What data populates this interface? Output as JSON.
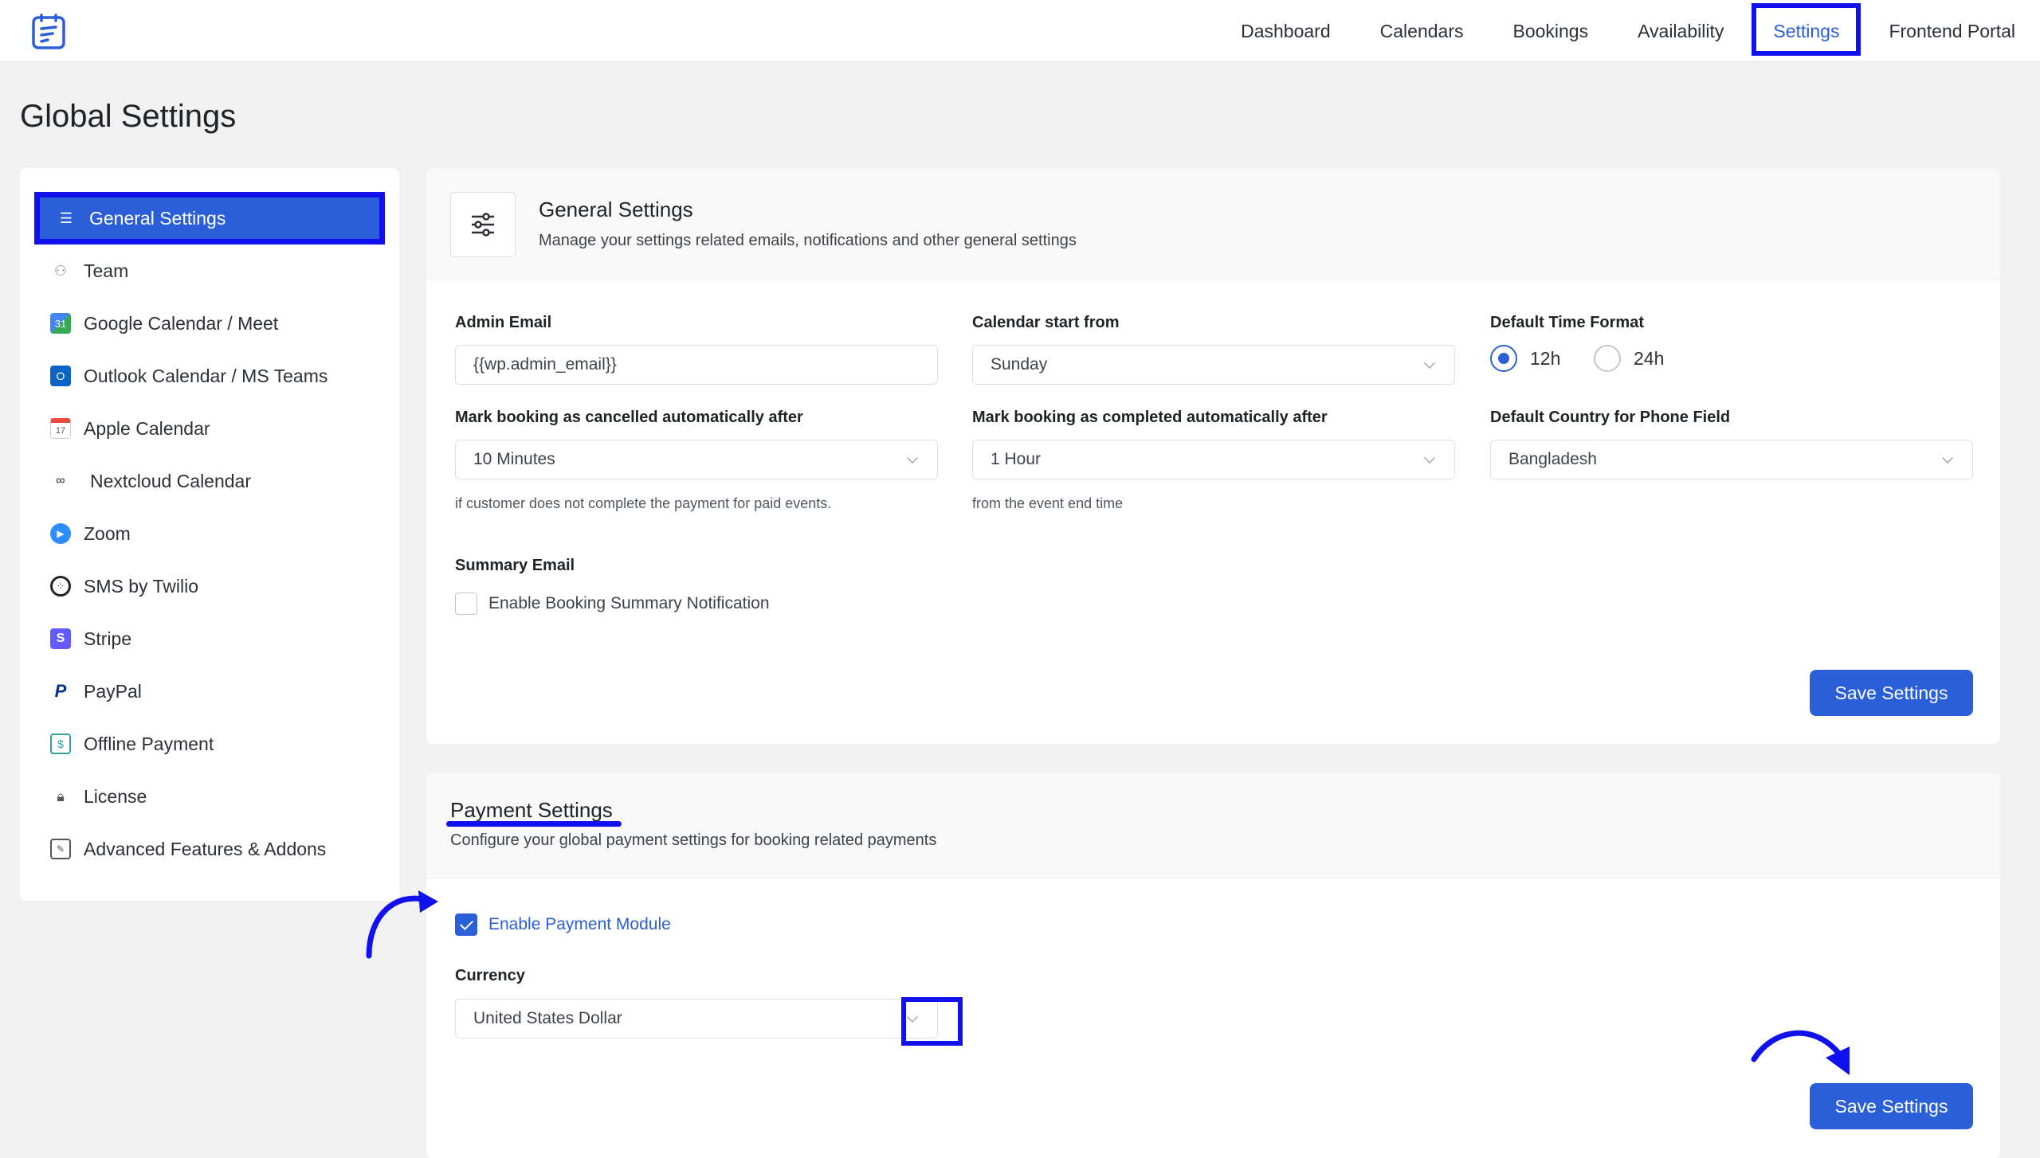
{
  "nav": {
    "items": [
      {
        "label": "Dashboard"
      },
      {
        "label": "Calendars"
      },
      {
        "label": "Bookings"
      },
      {
        "label": "Availability"
      },
      {
        "label": "Settings"
      },
      {
        "label": "Frontend Portal"
      }
    ],
    "active": "Settings"
  },
  "page": {
    "title": "Global Settings"
  },
  "sidebar": {
    "items": [
      {
        "label": "General Settings",
        "icon": "sliders-icon"
      },
      {
        "label": "Team",
        "icon": "team-icon"
      },
      {
        "label": "Google Calendar / Meet",
        "icon": "google-calendar-icon"
      },
      {
        "label": "Outlook Calendar / MS Teams",
        "icon": "outlook-icon"
      },
      {
        "label": "Apple Calendar",
        "icon": "apple-calendar-icon"
      },
      {
        "label": "Nextcloud Calendar",
        "icon": "nextcloud-icon"
      },
      {
        "label": "Zoom",
        "icon": "zoom-icon"
      },
      {
        "label": "SMS by Twilio",
        "icon": "twilio-icon"
      },
      {
        "label": "Stripe",
        "icon": "stripe-icon"
      },
      {
        "label": "PayPal",
        "icon": "paypal-icon"
      },
      {
        "label": "Offline Payment",
        "icon": "offline-payment-icon"
      },
      {
        "label": "License",
        "icon": "lock-icon"
      },
      {
        "label": "Advanced Features & Addons",
        "icon": "addons-icon"
      }
    ],
    "active": "General Settings"
  },
  "general": {
    "title": "General Settings",
    "description": "Manage your settings related emails, notifications and other general settings",
    "admin_email_label": "Admin Email",
    "admin_email_value": "{{wp.admin_email}}",
    "calendar_start_label": "Calendar start from",
    "calendar_start_value": "Sunday",
    "time_format_label": "Default Time Format",
    "time_format_options": [
      "12h",
      "24h"
    ],
    "time_format_selected": "12h",
    "cancel_label": "Mark booking as cancelled automatically after",
    "cancel_value": "10 Minutes",
    "cancel_hint": "if customer does not complete the payment for paid events.",
    "complete_label": "Mark booking as completed automatically after",
    "complete_value": "1 Hour",
    "complete_hint": "from the event end time",
    "country_label": "Default Country for Phone Field",
    "country_value": "Bangladesh",
    "summary_label": "Summary Email",
    "summary_checkbox": "Enable Booking Summary Notification",
    "summary_checked": false,
    "save_label": "Save Settings"
  },
  "payment": {
    "title": "Payment Settings",
    "description": "Configure your global payment settings for booking related payments",
    "enable_label": "Enable Payment Module",
    "enable_checked": true,
    "currency_label": "Currency",
    "currency_value": "United States Dollar",
    "save_label": "Save Settings"
  },
  "colors": {
    "primary": "#2b5fd9",
    "annotation": "#1111ee"
  }
}
